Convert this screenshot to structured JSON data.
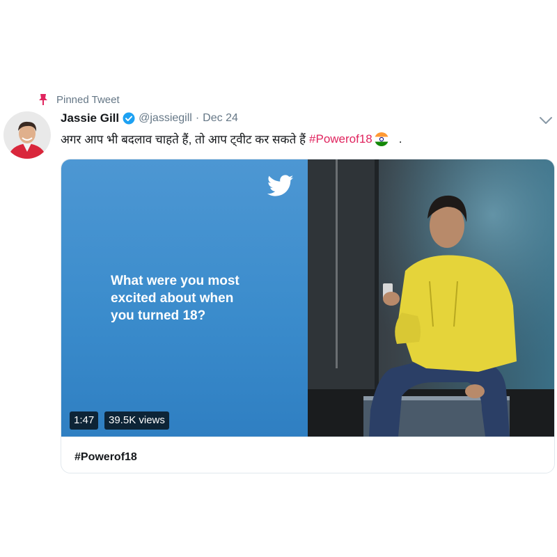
{
  "pinned": {
    "label": "Pinned Tweet",
    "icon": "pin-icon"
  },
  "author": {
    "name": "Jassie Gill",
    "handle": "@jassiegill",
    "separator": "·",
    "date": "Dec 24",
    "verified_icon": "verified-badge-icon"
  },
  "tweet": {
    "text": "अगर आप भी बदलाव चाहते हैं, तो आप ट्वीट कर सकते हैं",
    "hashtag": "#Powerof18",
    "emoji": "india-flag-emoji",
    "trailing": "."
  },
  "media": {
    "overlay_text": "What were you most\nexcited about when\nyou turned 18?",
    "duration": "1:47",
    "views": "39.5K views",
    "card_title": "#Powerof18"
  },
  "colors": {
    "hashtag": "#e0245e",
    "twitter_blue": "#1da1f2",
    "muted": "#657786",
    "panel_blue": "#3b8ccc"
  }
}
